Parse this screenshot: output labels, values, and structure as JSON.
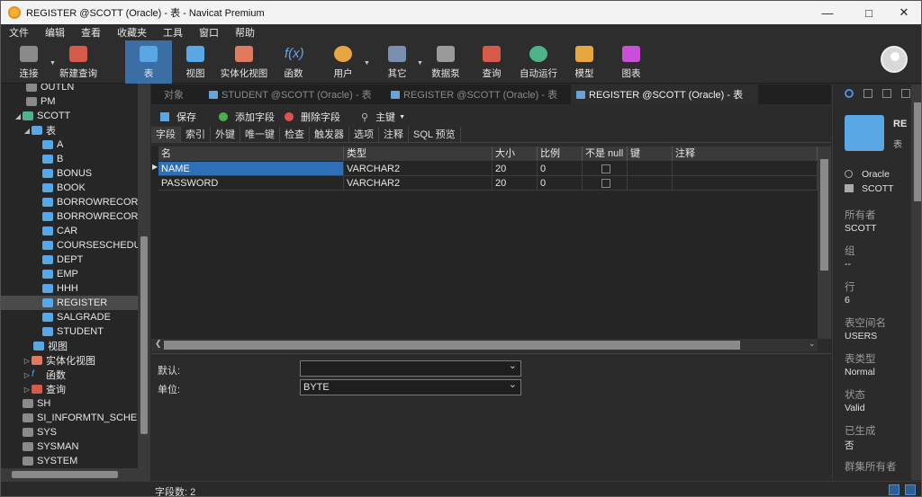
{
  "window": {
    "title": "REGISTER @SCOTT (Oracle) - 表 - Navicat Premium"
  },
  "menu": [
    "文件",
    "编辑",
    "查看",
    "收藏夹",
    "工具",
    "窗口",
    "帮助"
  ],
  "toolbar": {
    "connect": "连接",
    "new_query": "新建查询",
    "table": "表",
    "view": "视图",
    "mview": "实体化视图",
    "function": "函数",
    "user": "用户",
    "other": "其它",
    "datasource": "数据泵",
    "query": "查询",
    "automation": "自动运行",
    "model": "模型",
    "chart": "图表"
  },
  "tree": {
    "items": [
      "OUTLN",
      "PM",
      "SCOTT",
      "表",
      "A",
      "B",
      "BONUS",
      "BOOK",
      "BORROWRECORD",
      "BORROWRECORD",
      "CAR",
      "COURSESCHEDULE",
      "DEPT",
      "EMP",
      "HHH",
      "REGISTER",
      "SALGRADE",
      "STUDENT",
      "视图",
      "实体化视图",
      "函数",
      "查询",
      "SH",
      "SI_INFORMTN_SCHEMA",
      "SYS",
      "SYSMAN",
      "SYSTEM"
    ]
  },
  "tabs": [
    "对象",
    "STUDENT @SCOTT (Oracle) - 表",
    "REGISTER @SCOTT (Oracle) - 表",
    "REGISTER @SCOTT (Oracle) - 表"
  ],
  "actions": {
    "save": "保存",
    "add_field": "添加字段",
    "delete_field": "删除字段",
    "primary_key": "主键"
  },
  "subtabs": [
    "字段",
    "索引",
    "外键",
    "唯一键",
    "检查",
    "触发器",
    "选项",
    "注释",
    "SQL 预览"
  ],
  "grid": {
    "headers": [
      "名",
      "类型",
      "大小",
      "比例",
      "不是 null",
      "键",
      "注释"
    ],
    "rows": [
      {
        "name": "NAME",
        "type": "VARCHAR2",
        "size": "20",
        "scale": "0"
      },
      {
        "name": "PASSWORD",
        "type": "VARCHAR2",
        "size": "20",
        "scale": "0"
      }
    ]
  },
  "form": {
    "default_label": "默认:",
    "default_value": "",
    "unit_label": "单位:",
    "unit_value": "BYTE"
  },
  "status": {
    "field_count": "字段数: 2"
  },
  "info": {
    "title": "RE",
    "subtitle": "表",
    "db_type": "Oracle",
    "schema": "SCOTT",
    "props": [
      {
        "label": "所有者",
        "value": "SCOTT"
      },
      {
        "label": "组",
        "value": "--"
      },
      {
        "label": "行",
        "value": "6"
      },
      {
        "label": "表空间名",
        "value": "USERS"
      },
      {
        "label": "表类型",
        "value": "Normal"
      },
      {
        "label": "状态",
        "value": "Valid"
      },
      {
        "label": "已生成",
        "value": "否"
      },
      {
        "label": "群集所有者",
        "value": ""
      }
    ]
  },
  "colors": {
    "accent": "#3a6ea5",
    "selection": "#2f6fb5",
    "background": "#2b2b2b"
  }
}
